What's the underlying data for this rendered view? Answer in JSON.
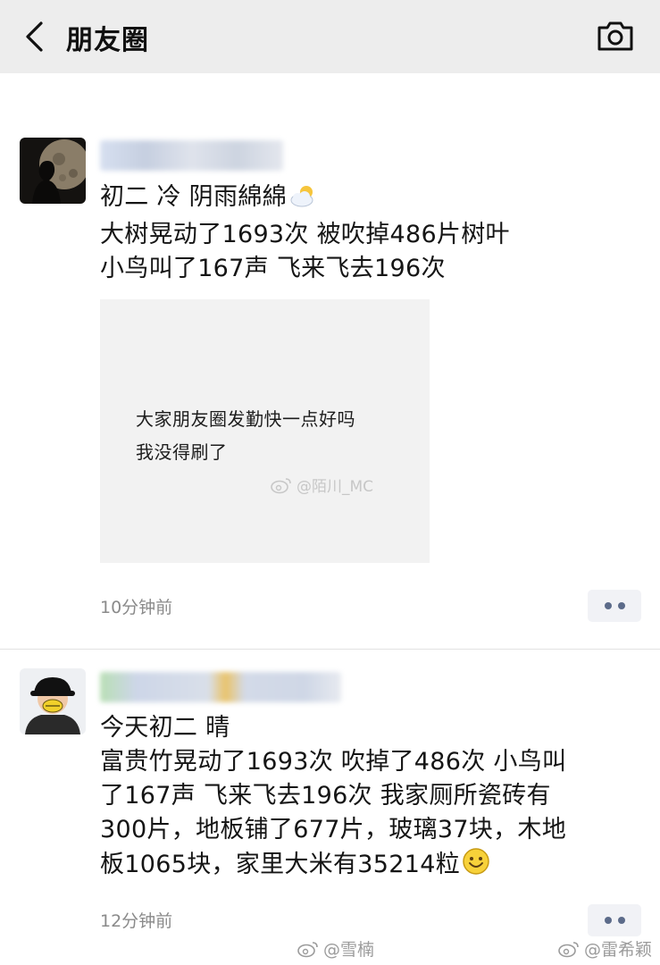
{
  "header": {
    "title": "朋友圈",
    "back_icon": "chevron-left-icon",
    "camera_icon": "camera-icon",
    "background": "#ededed"
  },
  "posts": [
    {
      "text_lines": [
        "初二 冷 阴雨綿綿",
        "大树晃动了1693次 被吹掉486片树叶",
        "小鸟叫了167声 飞来飞去196次"
      ],
      "emoji": "cloud-sun-emoji",
      "image": {
        "lines": [
          "大家朋友圈发勤快一点好吗",
          "我没得刷了"
        ],
        "watermark": "@陌川_MC"
      },
      "timestamp": "10分钟前"
    },
    {
      "text_lines": [
        "今天初二 晴",
        "富贵竹晃动了1693次 吹掉了486次 小鸟叫",
        "了167声 飞来飞去196次 我家厕所瓷砖有",
        "300片，地板铺了677片，玻璃37块，木地",
        "板1065块，家里大米有35214粒"
      ],
      "emoji": "smile-emoji",
      "timestamp": "12分钟前"
    }
  ],
  "watermarks": [
    "@雪楠",
    "@雷希颖"
  ],
  "colors": {
    "more_button_bg": "#f1f2f6",
    "more_button_dots": "#5c6b8a",
    "timestamp": "#8a8a8a"
  }
}
